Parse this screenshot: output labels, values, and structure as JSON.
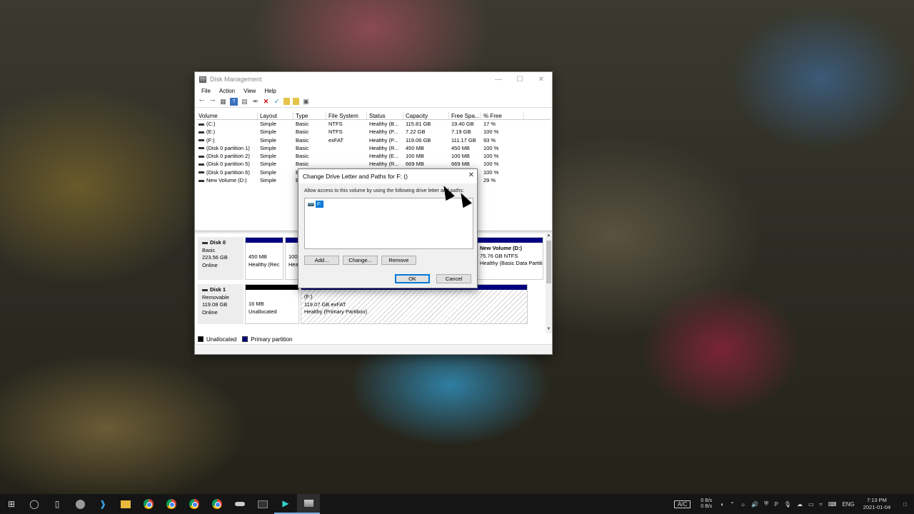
{
  "window": {
    "title": "Disk Management"
  },
  "menu": [
    "File",
    "Action",
    "View",
    "Help"
  ],
  "volumes": {
    "headers": [
      "Volume",
      "Layout",
      "Type",
      "File System",
      "Status",
      "Capacity",
      "Free Spa...",
      "% Free"
    ],
    "rows": [
      [
        "(C:)",
        "Simple",
        "Basic",
        "NTFS",
        "Healthy (B...",
        "115.81 GB",
        "19.40 GB",
        "17 %"
      ],
      [
        "(E:)",
        "Simple",
        "Basic",
        "NTFS",
        "Healthy (P...",
        "7.22 GB",
        "7.19 GB",
        "100 %"
      ],
      [
        "(F:)",
        "Simple",
        "Basic",
        "exFAT",
        "Healthy (P...",
        "119.06 GB",
        "111.17 GB",
        "93 %"
      ],
      [
        "(Disk 0 partition 1)",
        "Simple",
        "Basic",
        "",
        "Healthy (R...",
        "450 MB",
        "450 MB",
        "100 %"
      ],
      [
        "(Disk 0 partition 2)",
        "Simple",
        "Basic",
        "",
        "Healthy (E...",
        "100 MB",
        "100 MB",
        "100 %"
      ],
      [
        "(Disk 0 partition 5)",
        "Simple",
        "Basic",
        "",
        "Healthy (R...",
        "669 MB",
        "669 MB",
        "100 %"
      ],
      [
        "(Disk 0 partition 6)",
        "Simple",
        "E",
        "",
        "",
        "",
        "",
        "100 %"
      ],
      [
        "New Volume (D:)",
        "Simple",
        "E",
        "",
        "",
        "",
        "",
        "29 %"
      ]
    ]
  },
  "disk0": {
    "name": "Disk 0",
    "type": "Basic",
    "size": "223.56 GB",
    "state": "Online",
    "p1_size": "450 MB",
    "p1_status": "Healthy (Rec",
    "p2_size": "100 I",
    "p2_status": "Hea",
    "p3_name": "New Volume  (D:)",
    "p3_size": "75.76 GB NTFS",
    "p3_status": "Healthy (Basic Data Partitic"
  },
  "disk1": {
    "name": "Disk 1",
    "type": "Removable",
    "size": "119.08 GB",
    "state": "Online",
    "p1_size": "16 MB",
    "p1_status": "Unallocated",
    "p2_name": "(F:)",
    "p2_size": "119.07 GB exFAT",
    "p2_status": "Healthy (Primary Partition)"
  },
  "legend": {
    "unallocated": "Unallocated",
    "primary": "Primary partition"
  },
  "dialog": {
    "title": "Change Drive Letter and Paths for F: ()",
    "description": "Allow access to this volume by using the following drive letter and paths:",
    "list_item": "F:",
    "add": "Add...",
    "change": "Change...",
    "remove": "Remove",
    "ok": "OK",
    "cancel": "Cancel"
  },
  "tray": {
    "ac": "A/C",
    "net_up": "0 B/s",
    "net_down": "0 B/s",
    "lang": "ENG",
    "time": "7:13 PM",
    "date": "2021-01-04"
  },
  "colors": {
    "primary_partition": "#000080",
    "unallocated": "#000000",
    "selection": "#0078d7"
  }
}
